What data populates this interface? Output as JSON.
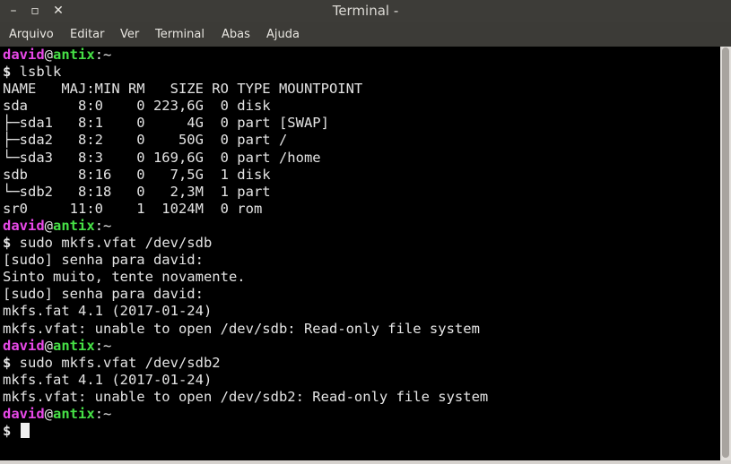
{
  "window": {
    "title": "Terminal -",
    "minimize_glyph": "–",
    "maximize_glyph": "▫",
    "close_glyph": "✕"
  },
  "menu": [
    "Arquivo",
    "Editar",
    "Ver",
    "Terminal",
    "Abas",
    "Ajuda"
  ],
  "prompt": {
    "user": "david",
    "at": "@",
    "host": "antix",
    "path": ":~",
    "symbol": "$"
  },
  "lines": [
    {
      "type": "prompt"
    },
    {
      "type": "command",
      "text": "lsblk"
    },
    {
      "type": "output",
      "text": "NAME   MAJ:MIN RM   SIZE RO TYPE MOUNTPOINT"
    },
    {
      "type": "output",
      "text": "sda      8:0    0 223,6G  0 disk"
    },
    {
      "type": "output",
      "text": "├─sda1   8:1    0     4G  0 part [SWAP]"
    },
    {
      "type": "output",
      "text": "├─sda2   8:2    0    50G  0 part /"
    },
    {
      "type": "output",
      "text": "└─sda3   8:3    0 169,6G  0 part /home"
    },
    {
      "type": "output",
      "text": "sdb      8:16   0   7,5G  1 disk"
    },
    {
      "type": "output",
      "text": "└─sdb2   8:18   0   2,3M  1 part"
    },
    {
      "type": "output",
      "text": "sr0     11:0    1  1024M  0 rom"
    },
    {
      "type": "prompt"
    },
    {
      "type": "command",
      "text": "sudo mkfs.vfat /dev/sdb"
    },
    {
      "type": "output",
      "text": "[sudo] senha para david:"
    },
    {
      "type": "output",
      "text": "Sinto muito, tente novamente."
    },
    {
      "type": "output",
      "text": "[sudo] senha para david:"
    },
    {
      "type": "output",
      "text": "mkfs.fat 4.1 (2017-01-24)"
    },
    {
      "type": "output",
      "text": "mkfs.vfat: unable to open /dev/sdb: Read-only file system"
    },
    {
      "type": "prompt"
    },
    {
      "type": "command",
      "text": "sudo mkfs.vfat /dev/sdb2"
    },
    {
      "type": "output",
      "text": "mkfs.fat 4.1 (2017-01-24)"
    },
    {
      "type": "output",
      "text": "mkfs.vfat: unable to open /dev/sdb2: Read-only file system"
    },
    {
      "type": "prompt"
    },
    {
      "type": "command",
      "text": "",
      "cursor": true
    }
  ],
  "colors": {
    "user": "#e848e8",
    "host": "#46e046",
    "text": "#e4e4e4",
    "background": "#000000",
    "chrome": "#3c3b37"
  }
}
